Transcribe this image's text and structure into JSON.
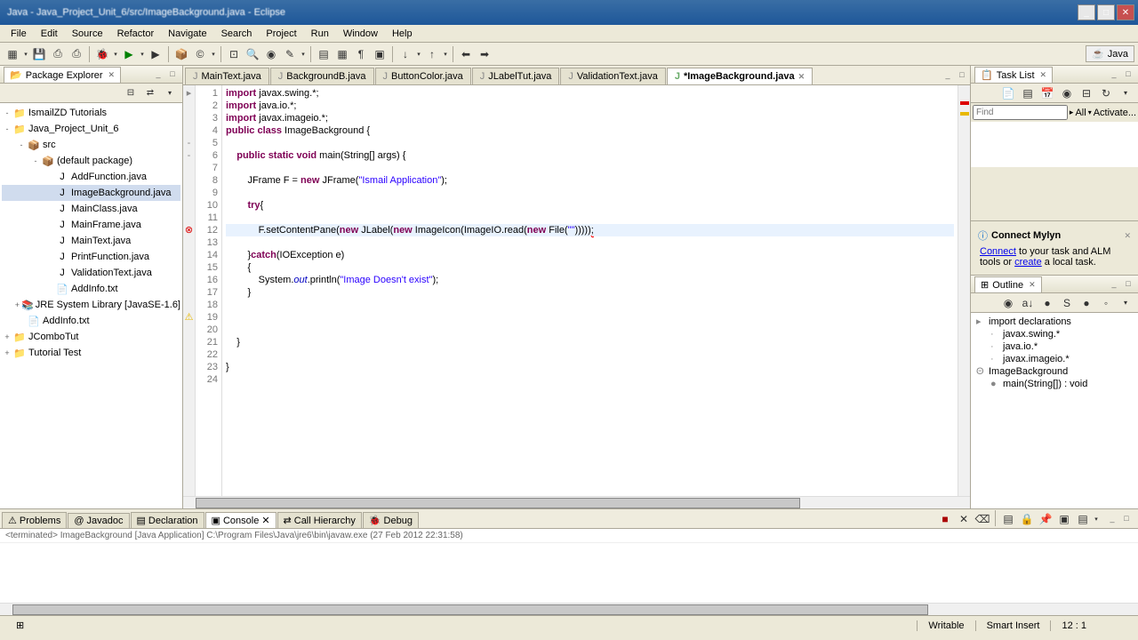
{
  "window": {
    "title": "Java - Java_Project_Unit_6/src/ImageBackground.java - Eclipse"
  },
  "menu": [
    "File",
    "Edit",
    "Source",
    "Refactor",
    "Navigate",
    "Search",
    "Project",
    "Run",
    "Window",
    "Help"
  ],
  "perspective": "Java",
  "package_explorer": {
    "title": "Package Explorer",
    "tree": [
      {
        "level": 0,
        "expand": "-",
        "icon": "📁",
        "label": "IsmailZD Tutorials"
      },
      {
        "level": 0,
        "expand": "-",
        "icon": "📁",
        "label": "Java_Project_Unit_6"
      },
      {
        "level": 1,
        "expand": "-",
        "icon": "📦",
        "label": "src"
      },
      {
        "level": 2,
        "expand": "-",
        "icon": "📦",
        "label": "(default package)"
      },
      {
        "level": 3,
        "expand": "",
        "icon": "J",
        "label": "AddFunction.java"
      },
      {
        "level": 3,
        "expand": "",
        "icon": "J",
        "label": "ImageBackground.java",
        "selected": true
      },
      {
        "level": 3,
        "expand": "",
        "icon": "J",
        "label": "MainClass.java"
      },
      {
        "level": 3,
        "expand": "",
        "icon": "J",
        "label": "MainFrame.java"
      },
      {
        "level": 3,
        "expand": "",
        "icon": "J",
        "label": "MainText.java"
      },
      {
        "level": 3,
        "expand": "",
        "icon": "J",
        "label": "PrintFunction.java"
      },
      {
        "level": 3,
        "expand": "",
        "icon": "J",
        "label": "ValidationText.java"
      },
      {
        "level": 3,
        "expand": "",
        "icon": "📄",
        "label": "AddInfo.txt"
      },
      {
        "level": 1,
        "expand": "+",
        "icon": "📚",
        "label": "JRE System Library [JavaSE-1.6]"
      },
      {
        "level": 1,
        "expand": "",
        "icon": "📄",
        "label": "AddInfo.txt"
      },
      {
        "level": 0,
        "expand": "+",
        "icon": "📁",
        "label": "JComboTut"
      },
      {
        "level": 0,
        "expand": "+",
        "icon": "📁",
        "label": "Tutorial Test"
      }
    ]
  },
  "editor": {
    "tabs": [
      {
        "label": "MainText.java",
        "active": false
      },
      {
        "label": "BackgroundB.java",
        "active": false
      },
      {
        "label": "ButtonColor.java",
        "active": false
      },
      {
        "label": "JLabelTut.java",
        "active": false
      },
      {
        "label": "ValidationText.java",
        "active": false
      },
      {
        "label": "ImageBackground.java",
        "active": true,
        "dirty": true
      }
    ],
    "lines": [
      {
        "n": 1,
        "marker": "▸"
      },
      {
        "n": 2
      },
      {
        "n": 3
      },
      {
        "n": 4
      },
      {
        "n": 5,
        "marker": "-"
      },
      {
        "n": 6,
        "marker": "-"
      },
      {
        "n": 7
      },
      {
        "n": 8
      },
      {
        "n": 9
      },
      {
        "n": 10
      },
      {
        "n": 11
      },
      {
        "n": 12,
        "marker": "⊗",
        "highlight": true
      },
      {
        "n": 13
      },
      {
        "n": 14
      },
      {
        "n": 15
      },
      {
        "n": 16
      },
      {
        "n": 17
      },
      {
        "n": 18
      },
      {
        "n": 19,
        "marker": "⚠"
      },
      {
        "n": 20
      },
      {
        "n": 21
      },
      {
        "n": 22
      },
      {
        "n": 23
      },
      {
        "n": 24
      }
    ]
  },
  "task_list": {
    "title": "Task List",
    "find_label": "Find",
    "all_label": "All",
    "activate_label": "Activate..."
  },
  "mylyn": {
    "title": "Connect Mylyn",
    "connect": "Connect",
    "text1": " to your task and ALM tools or ",
    "create": "create",
    "text2": " a local task."
  },
  "outline": {
    "title": "Outline",
    "items": [
      {
        "level": 0,
        "icon": "▸",
        "label": "import declarations"
      },
      {
        "level": 1,
        "icon": "·",
        "label": "javax.swing.*"
      },
      {
        "level": 1,
        "icon": "·",
        "label": "java.io.*"
      },
      {
        "level": 1,
        "icon": "·",
        "label": "javax.imageio.*"
      },
      {
        "level": 0,
        "icon": "Θ",
        "label": "ImageBackground"
      },
      {
        "level": 1,
        "icon": "●",
        "label": "main(String[]) : void"
      }
    ]
  },
  "bottom": {
    "tabs": [
      "Problems",
      "Javadoc",
      "Declaration",
      "Console",
      "Call Hierarchy",
      "Debug"
    ],
    "active_tab": "Console",
    "status": "<terminated> ImageBackground [Java Application] C:\\Program Files\\Java\\jre6\\bin\\javaw.exe (27 Feb 2012 22:31:58)"
  },
  "statusbar": {
    "writable": "Writable",
    "insert": "Smart Insert",
    "pos": "12 : 1"
  }
}
